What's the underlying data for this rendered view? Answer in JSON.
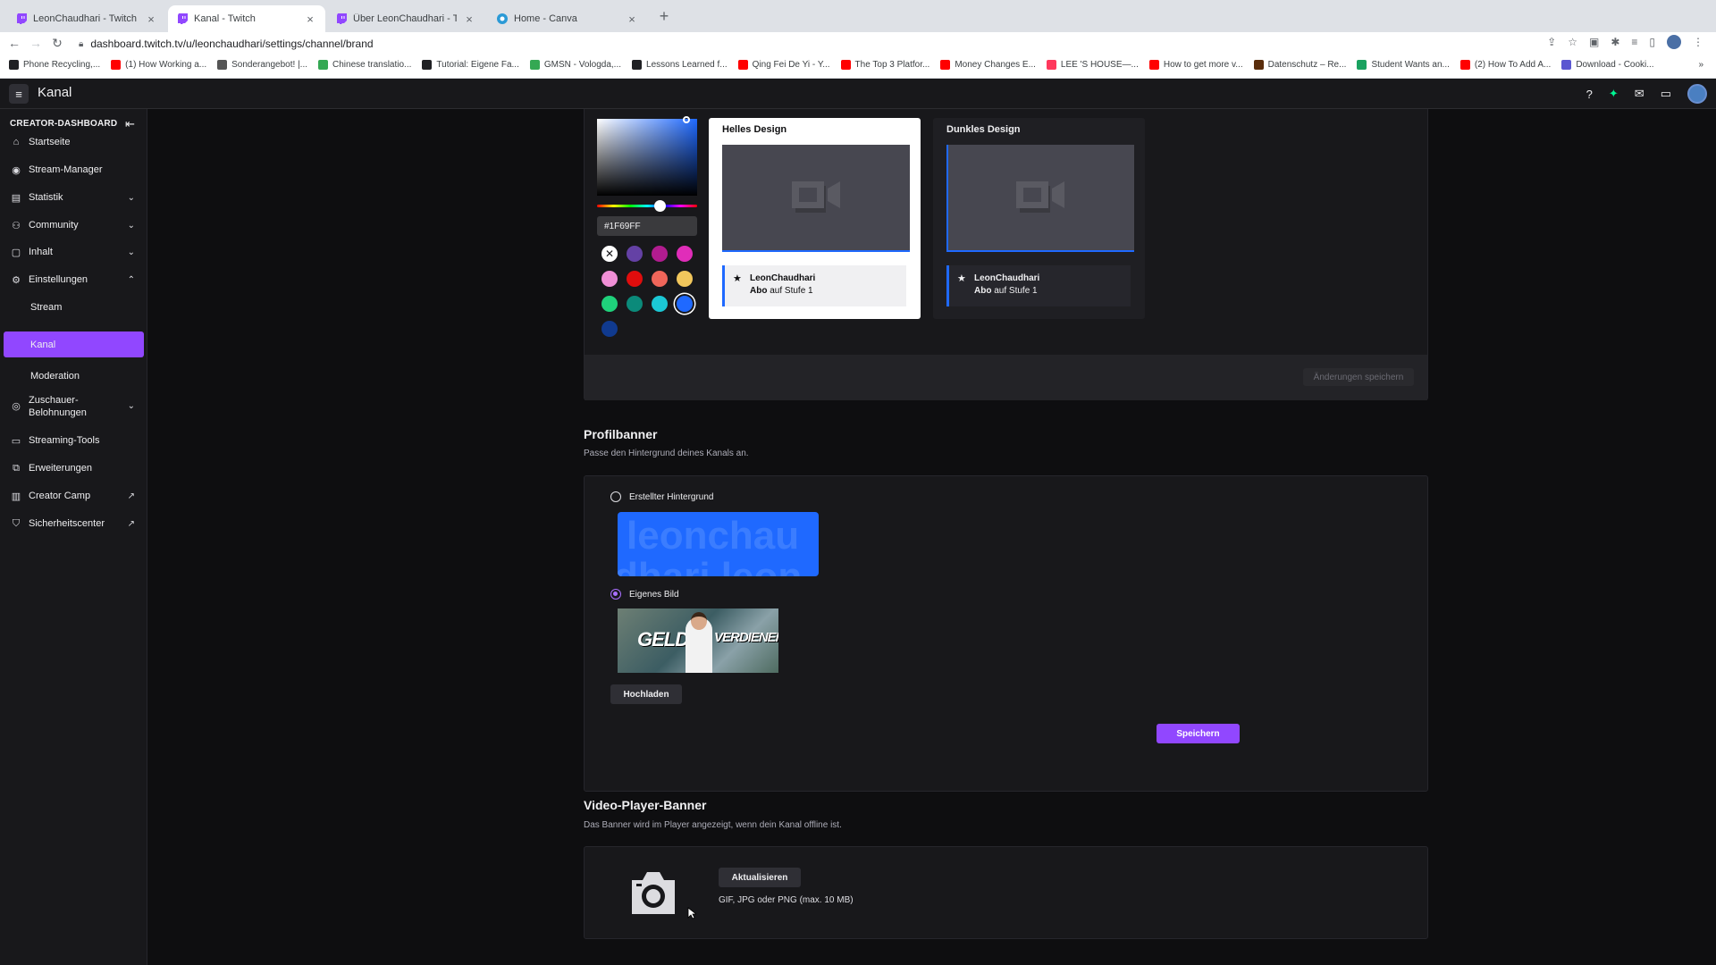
{
  "browser": {
    "tabs": [
      {
        "title": "LeonChaudhari - Twitch",
        "icon": "twitch-icon"
      },
      {
        "title": "Kanal - Twitch",
        "icon": "twitch-icon"
      },
      {
        "title": "Über LeonChaudhari - Twitch",
        "icon": "twitch-icon"
      },
      {
        "title": "Home - Canva",
        "icon": "canva-icon"
      }
    ],
    "url": "dashboard.twitch.tv/u/leonchaudhari/settings/channel/brand",
    "bookmarks": [
      {
        "label": "Phone Recycling,...",
        "color": "#202124"
      },
      {
        "label": "(1) How Working a...",
        "color": "#ff0000"
      },
      {
        "label": "Sonderangebot! |...",
        "color": "#555555"
      },
      {
        "label": "Chinese translatio...",
        "color": "#34a853"
      },
      {
        "label": "Tutorial: Eigene Fa...",
        "color": "#202124"
      },
      {
        "label": "GMSN - Vologda,...",
        "color": "#34a853"
      },
      {
        "label": "Lessons Learned f...",
        "color": "#202124"
      },
      {
        "label": "Qing Fei De Yi - Y...",
        "color": "#ff0000"
      },
      {
        "label": "The Top 3 Platfor...",
        "color": "#ff0000"
      },
      {
        "label": "Money Changes E...",
        "color": "#ff0000"
      },
      {
        "label": "LEE 'S HOUSE—...",
        "color": "#ff385c"
      },
      {
        "label": "How to get more v...",
        "color": "#ff0000"
      },
      {
        "label": "Datenschutz – Re...",
        "color": "#5a2d0c"
      },
      {
        "label": "Student Wants an...",
        "color": "#1aa260"
      },
      {
        "label": "(2) How To Add A...",
        "color": "#ff0000"
      },
      {
        "label": "Download - Cooki...",
        "color": "#5b57d1"
      }
    ]
  },
  "app": {
    "title": "Kanal"
  },
  "sidebar": {
    "header": "CREATOR-DASHBOARD",
    "items": [
      {
        "label": "Startseite",
        "icon": "home-icon"
      },
      {
        "label": "Stream-Manager",
        "icon": "broadcast-icon"
      },
      {
        "label": "Statistik",
        "icon": "stats-icon"
      },
      {
        "label": "Community",
        "icon": "community-icon"
      },
      {
        "label": "Inhalt",
        "icon": "content-icon"
      },
      {
        "label": "Einstellungen",
        "icon": "gear-icon"
      },
      {
        "label": "Stream"
      },
      {
        "label": "Kanal"
      },
      {
        "label": "Moderation"
      },
      {
        "label": "Zuschauer-\nBelohnungen",
        "icon": "reward-icon"
      },
      {
        "label": "Streaming-Tools",
        "icon": "camera-icon"
      },
      {
        "label": "Erweiterungen",
        "icon": "extension-icon"
      },
      {
        "label": "Creator Camp",
        "icon": "book-icon"
      },
      {
        "label": "Sicherheitscenter",
        "icon": "shield-icon"
      }
    ]
  },
  "color_picker": {
    "hex_value": "#1F69FF",
    "swatches": [
      "#6441a5",
      "#b11c8f",
      "#e02db9",
      "#f08fd6",
      "#e00d0d",
      "#f0665a",
      "#f2c75c",
      "#1fd17b",
      "#0b8a7a",
      "#1bc7d4",
      "#1f69ff",
      "#103a8f"
    ]
  },
  "preview": {
    "light_title": "Helles Design",
    "dark_title": "Dunkles Design",
    "user": "LeonChaudhari",
    "sub_bold": "Abo",
    "sub_rest": "auf Stufe 1"
  },
  "save_changes_label": "Änderungen speichern",
  "profile_banner": {
    "title": "Profilbanner",
    "description": "Passe den Hintergrund deines Kanals an.",
    "option_generated": "Erstellter Hintergrund",
    "generated_text_1": "leonchau",
    "generated_text_2": "dhari leon",
    "option_custom": "Eigenes Bild",
    "banner_text_1": "GELD",
    "banner_text_2": "VERDIENEN",
    "upload_label": "Hochladen",
    "save_label": "Speichern"
  },
  "video_banner": {
    "title": "Video-Player-Banner",
    "description": "Das Banner wird im Player angezeigt, wenn dein Kanal offline ist.",
    "update_label": "Aktualisieren",
    "hint": "GIF, JPG oder PNG (max. 10 MB)"
  }
}
